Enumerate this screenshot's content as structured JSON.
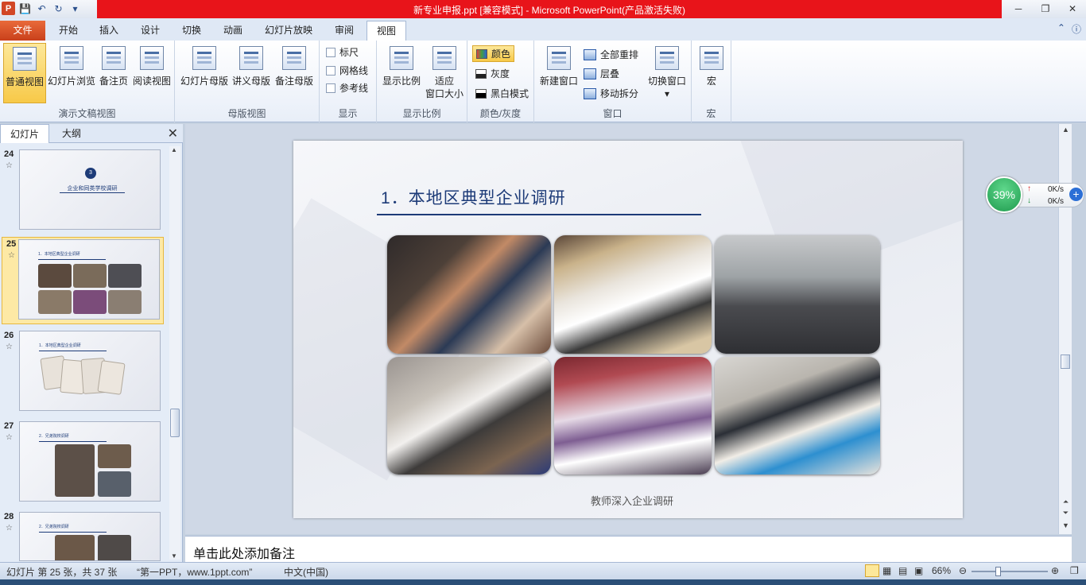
{
  "window": {
    "title": "新专业申报.ppt [兼容模式]  -  Microsoft PowerPoint(产品激活失败)"
  },
  "ribbon_tabs": [
    "文件",
    "开始",
    "插入",
    "设计",
    "切换",
    "动画",
    "幻灯片放映",
    "审阅",
    "视图"
  ],
  "ribbon": {
    "presentation_views": {
      "group_label": "演示文稿视图",
      "normal": "普通视图",
      "sorter": "幻灯片浏览",
      "notes_page": "备注页",
      "reading": "阅读视图"
    },
    "master_views": {
      "group_label": "母版视图",
      "slide_master": "幻灯片母版",
      "handout_master": "讲义母版",
      "notes_master": "备注母版"
    },
    "show": {
      "group_label": "显示",
      "ruler": "标尺",
      "gridlines": "网格线",
      "guides": "参考线"
    },
    "zoom": {
      "group_label": "显示比例",
      "zoom": "显示比例",
      "fit_line1": "适应",
      "fit_line2": "窗口大小"
    },
    "color": {
      "group_label": "颜色/灰度",
      "color": "颜色",
      "grayscale": "灰度",
      "bw": "黑白模式"
    },
    "window": {
      "group_label": "窗口",
      "new_window": "新建窗口",
      "arrange_all": "全部重排",
      "cascade": "层叠",
      "move_split": "移动拆分",
      "switch_windows": "切换窗口"
    },
    "macros": {
      "group_label": "宏",
      "macros": "宏"
    }
  },
  "left_pane": {
    "tab_slides": "幻灯片",
    "tab_outline": "大纲",
    "slides": [
      {
        "num": "24",
        "badge": "3",
        "title": "企业和同类学校调研"
      },
      {
        "num": "25",
        "title": "1．本地区典型企业调研"
      },
      {
        "num": "26",
        "title": "1．本地区典型企业调研"
      },
      {
        "num": "27",
        "title": "2．兄弟院校调研"
      },
      {
        "num": "28",
        "title": "2．兄弟院校调研"
      }
    ]
  },
  "slide": {
    "title": "1．本地区典型企业调研",
    "caption": "教师深入企业调研"
  },
  "notes": {
    "placeholder": "单击此处添加备注"
  },
  "status": {
    "slide_count": "幻灯片 第 25 张，共 37 张",
    "theme": "“第一PPT，www.1ppt.com”",
    "language": "中文(中国)",
    "zoom": "66%"
  },
  "net_widget": {
    "percent": "39%",
    "upload": "0K/s",
    "download": "0K/s"
  }
}
